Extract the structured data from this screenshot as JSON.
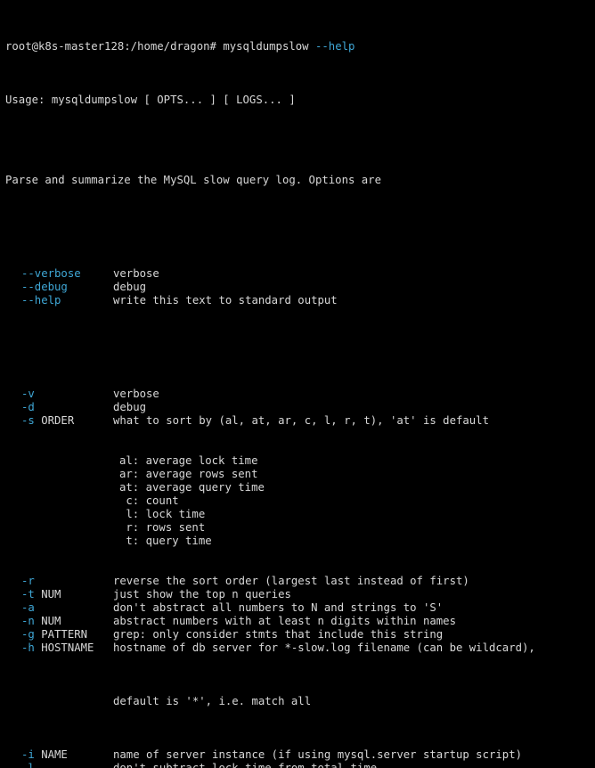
{
  "colors": {
    "background": "#000000",
    "text": "#d8d8d8",
    "option_flag": "#3fa7d6"
  },
  "terminal": {
    "prompt": "root@k8s-master128:/home/dragon#",
    "command": "mysqldumpslow",
    "command_arg": "--help",
    "usage": "Usage: mysqldumpslow [ OPTS... ] [ LOGS... ]",
    "intro": "Parse and summarize the MySQL slow query log. Options are",
    "long_options": [
      {
        "flag": "--verbose",
        "arg": "",
        "desc": "verbose"
      },
      {
        "flag": "--debug",
        "arg": "",
        "desc": "debug"
      },
      {
        "flag": "--help",
        "arg": "",
        "desc": "write this text to standard output"
      }
    ],
    "short_options_a": [
      {
        "flag": "-v",
        "arg": "",
        "desc": "verbose"
      },
      {
        "flag": "-d",
        "arg": "",
        "desc": "debug"
      },
      {
        "flag": "-s",
        "arg": " ORDER",
        "desc": "what to sort by (al, at, ar, c, l, r, t), 'at' is default"
      }
    ],
    "sort_keys": [
      {
        "text": "al: average lock time"
      },
      {
        "text": "ar: average rows sent"
      },
      {
        "text": "at: average query time"
      },
      {
        "text": " c: count"
      },
      {
        "text": " l: lock time"
      },
      {
        "text": " r: rows sent"
      },
      {
        "text": " t: query time"
      }
    ],
    "short_options_b": [
      {
        "flag": "-r",
        "arg": "",
        "desc": "reverse the sort order (largest last instead of first)"
      },
      {
        "flag": "-t",
        "arg": " NUM",
        "desc": "just show the top n queries"
      },
      {
        "flag": "-a",
        "arg": "",
        "desc": "don't abstract all numbers to N and strings to 'S'"
      },
      {
        "flag": "-n",
        "arg": " NUM",
        "desc": "abstract numbers with at least n digits within names"
      },
      {
        "flag": "-g",
        "arg": " PATTERN",
        "desc": "grep: only consider stmts that include this string"
      },
      {
        "flag": "-h",
        "arg": " HOSTNAME",
        "desc": "hostname of db server for *-slow.log filename (can be wildcard),"
      }
    ],
    "h_continuation": "default is '*', i.e. match all",
    "short_options_c": [
      {
        "flag": "-i",
        "arg": " NAME",
        "desc": "name of server instance (if using mysql.server startup script)"
      },
      {
        "flag": "-l",
        "arg": "",
        "desc": "don't subtract lock time from total time"
      }
    ]
  }
}
